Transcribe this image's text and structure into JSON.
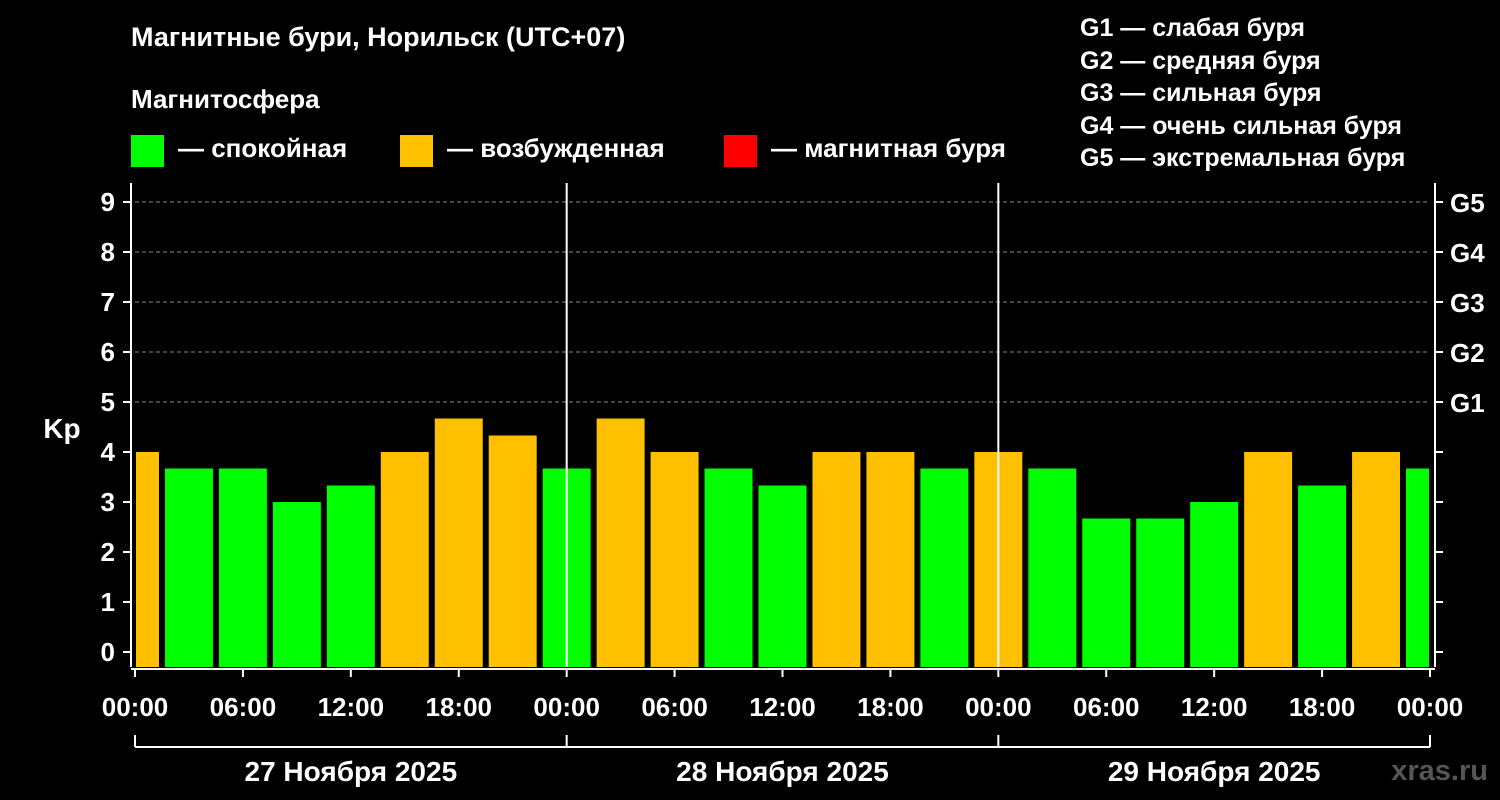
{
  "title": "Магнитные бури, Норильск (UTC+07)",
  "subtitle": "Магнитосфера",
  "legend": [
    {
      "label": "— спокойная",
      "color": "#00ff00"
    },
    {
      "label": "— возбужденная",
      "color": "#ffc000"
    },
    {
      "label": "— магнитная буря",
      "color": "#ff0000"
    }
  ],
  "storm_scale": [
    "G1 — слабая буря",
    "G2 — средняя буря",
    "G3 — сильная буря",
    "G4 — очень сильная буря",
    "G5 — экстремальная буря"
  ],
  "watermark": "xras.ru",
  "chart_data": {
    "type": "bar",
    "ylabel": "Kp",
    "ylim": [
      0,
      9
    ],
    "yticks": [
      0,
      1,
      2,
      3,
      4,
      5,
      6,
      7,
      8,
      9
    ],
    "g_ticks": [
      {
        "kp": 5,
        "label": "G1"
      },
      {
        "kp": 6,
        "label": "G2"
      },
      {
        "kp": 7,
        "label": "G3"
      },
      {
        "kp": 8,
        "label": "G4"
      },
      {
        "kp": 9,
        "label": "G5"
      }
    ],
    "x_tick_labels": [
      "00:00",
      "06:00",
      "12:00",
      "18:00",
      "00:00",
      "06:00",
      "12:00",
      "18:00",
      "00:00",
      "06:00",
      "12:00",
      "18:00",
      "00:00"
    ],
    "days": [
      "27 Ноября 2025",
      "28 Ноября 2025",
      "29 Ноября 2025"
    ],
    "grid": "dashed horizontal",
    "thresholds": {
      "quiet_below": 4,
      "storm_from": 5
    },
    "bar_hours_utc7": [
      0,
      3,
      6,
      9,
      12,
      15,
      18,
      21,
      24,
      27,
      30,
      33,
      36,
      39,
      42,
      45,
      48,
      51,
      54,
      57,
      60,
      63,
      66,
      69
    ],
    "values": [
      4.0,
      3.67,
      3.67,
      3.0,
      3.33,
      4.0,
      4.67,
      4.33,
      3.67,
      4.67,
      4.0,
      3.67,
      3.33,
      4.0,
      4.0,
      3.67,
      4.0,
      3.67,
      2.67,
      2.67,
      3.0,
      4.0,
      3.33,
      4.0,
      3.67
    ]
  }
}
